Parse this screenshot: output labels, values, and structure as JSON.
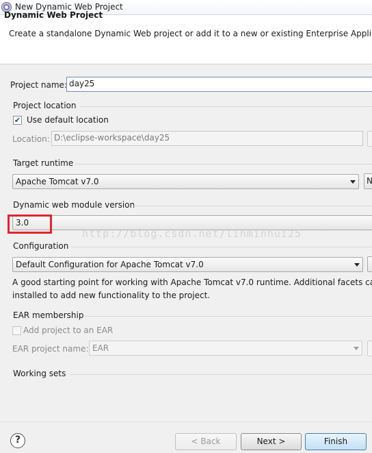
{
  "window": {
    "title": "New Dynamic Web Project"
  },
  "banner": {
    "title": "Dynamic Web Project",
    "description": "Create a standalone Dynamic Web project or add it to a new or existing Enterprise Applicati"
  },
  "project_name": {
    "label": "Project name:",
    "value": "day25"
  },
  "project_location": {
    "group_label": "Project location",
    "use_default_label": "Use default location",
    "use_default_checked": true,
    "location_label": "Location:",
    "location_value": "D:\\eclipse-workspace\\day25"
  },
  "target_runtime": {
    "group_label": "Target runtime",
    "selected": "Apache Tomcat v7.0",
    "new_button_fragment": "N"
  },
  "module_version": {
    "group_label": "Dynamic web module version",
    "selected": "3.0"
  },
  "watermark": "http://blog.csdn.net/linminhui25",
  "configuration": {
    "group_label": "Configuration",
    "selected": "Default Configuration for Apache Tomcat v7.0",
    "description_line1": "A good starting point for working with Apache Tomcat v7.0 runtime. Additional facets can",
    "description_line2": "installed to add new functionality to the project."
  },
  "ear": {
    "group_label": "EAR membership",
    "add_label": "Add project to an EAR",
    "add_checked": false,
    "project_name_label": "EAR project name:",
    "project_name_value": "EAR"
  },
  "working_sets": {
    "group_label": "Working sets"
  },
  "buttons": {
    "help": "?",
    "back": "< Back",
    "next": "Next >",
    "finish": "Finish"
  },
  "colors": {
    "highlight": "#e3242b",
    "default_button": "#3c7fb1"
  }
}
